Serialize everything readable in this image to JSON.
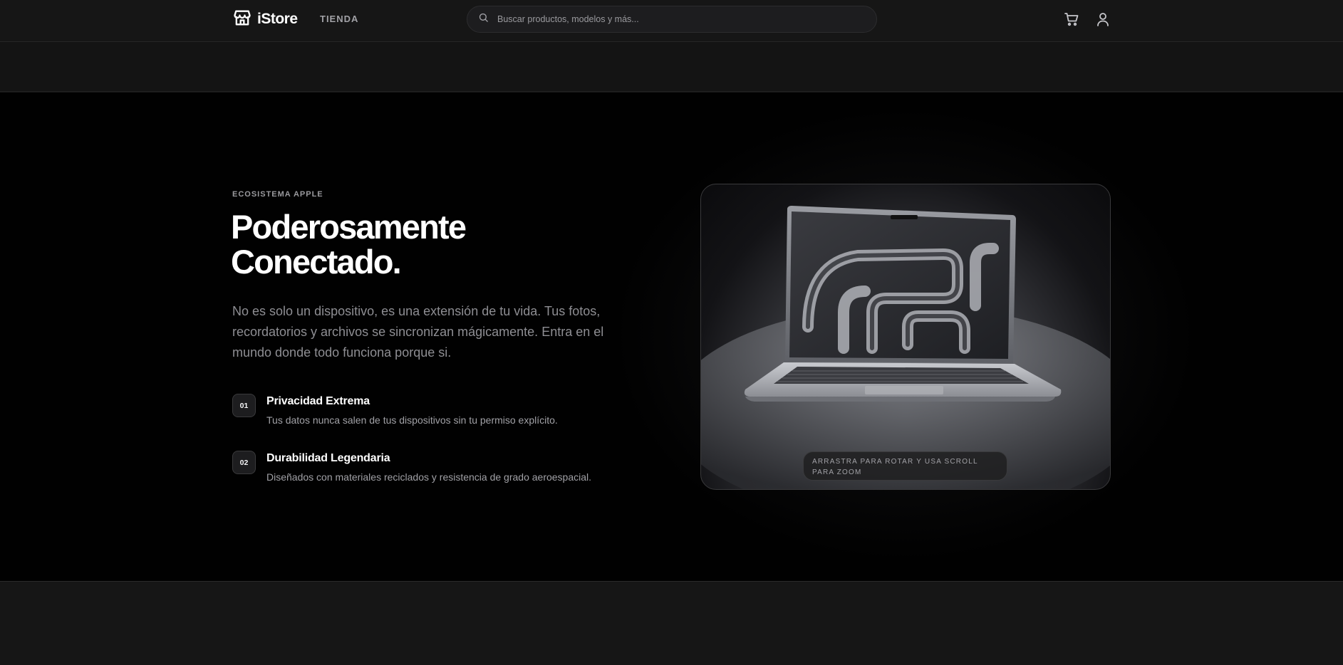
{
  "header": {
    "brand": "iStore",
    "nav_link": "TIENDA",
    "search_placeholder": "Buscar productos, modelos y más...",
    "icons": [
      "store-icon",
      "search-icon",
      "cart-icon",
      "user-icon"
    ]
  },
  "hero": {
    "eyebrow": "ECOSISTEMA APPLE",
    "title_line1": "Poderosamente",
    "title_line2": "Conectado.",
    "lead": "No es solo un dispositivo, es una extensión de tu vida. Tus fotos, recordatorios y archivos se sincronizan mágicamente. Entra en el mundo donde todo funciona porque si.",
    "features": [
      {
        "num": "01",
        "title": "Privacidad Extrema",
        "desc": "Tus datos nunca salen de tus dispositivos sin tu permiso explícito."
      },
      {
        "num": "02",
        "title": "Durabilidad Legendaria",
        "desc": "Diseñados con materiales reciclados y resistencia de grado aeroespacial."
      }
    ],
    "viewer_hint": "ARRASTRA PARA ROTAR Y USA SCROLL PARA ZOOM"
  },
  "colors": {
    "background": "#010101",
    "header": "#161616",
    "text_primary": "#ffffff",
    "text_secondary": "#8e8e93"
  }
}
